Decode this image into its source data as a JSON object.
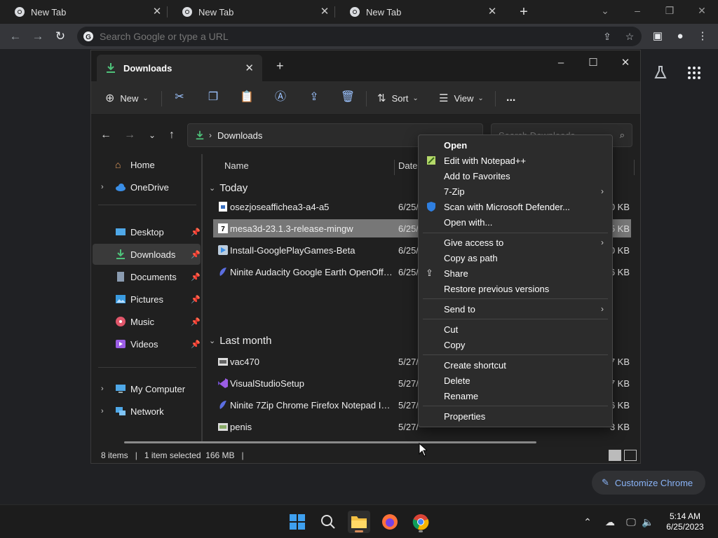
{
  "chrome": {
    "tabs": [
      {
        "title": "New Tab"
      },
      {
        "title": "New Tab"
      },
      {
        "title": "New Tab"
      }
    ],
    "omnibox_placeholder": "Search Google or type a URL",
    "customize_label": "Customize Chrome"
  },
  "explorer": {
    "tab_title": "Downloads",
    "commands": {
      "new_label": "New",
      "sort_label": "Sort",
      "view_label": "View",
      "more_label": "..."
    },
    "address": "Downloads",
    "search_placeholder": "Search Downloads",
    "sidebar": [
      {
        "label": "Home"
      },
      {
        "label": "OneDrive"
      },
      {
        "label": "Desktop"
      },
      {
        "label": "Downloads"
      },
      {
        "label": "Documents"
      },
      {
        "label": "Pictures"
      },
      {
        "label": "Music"
      },
      {
        "label": "Videos"
      },
      {
        "label": "My Computer"
      },
      {
        "label": "Network"
      }
    ],
    "columns": {
      "name": "Name",
      "date": "Date"
    },
    "groups": {
      "today": "Today",
      "last_month": "Last month"
    },
    "files": [
      {
        "name": "osezjoseaffichea3-a4-a5",
        "date": "6/25/",
        "size": "0 KB"
      },
      {
        "name": "mesa3d-23.1.3-release-mingw",
        "date": "6/25/",
        "size": "5 KB"
      },
      {
        "name": "Install-GooglePlayGames-Beta",
        "date": "6/25/",
        "size": "0 KB"
      },
      {
        "name": "Ninite Audacity Google Earth OpenOffice...",
        "date": "6/25/",
        "size": "6 KB"
      },
      {
        "name": "vac470",
        "date": "5/27/",
        "size": "7 KB"
      },
      {
        "name": "VisualStudioSetup",
        "date": "5/27/",
        "size": "7 KB"
      },
      {
        "name": "Ninite 7Zip Chrome Firefox Notepad Inst...",
        "date": "5/27/",
        "size": "6 KB"
      },
      {
        "name": "penis",
        "date": "5/27/",
        "size": "3 KB"
      }
    ],
    "status": {
      "items": "8 items",
      "selected": "1 item selected  166 MB"
    }
  },
  "context_menu": [
    {
      "label": "Open"
    },
    {
      "label": "Edit with Notepad++"
    },
    {
      "label": "Add to Favorites"
    },
    {
      "label": "7-Zip"
    },
    {
      "label": "Scan with Microsoft Defender..."
    },
    {
      "label": "Open with..."
    },
    {
      "label": "Give access to"
    },
    {
      "label": "Copy as path"
    },
    {
      "label": "Share"
    },
    {
      "label": "Restore previous versions"
    },
    {
      "label": "Send to"
    },
    {
      "label": "Cut"
    },
    {
      "label": "Copy"
    },
    {
      "label": "Create shortcut"
    },
    {
      "label": "Delete"
    },
    {
      "label": "Rename"
    },
    {
      "label": "Properties"
    }
  ],
  "taskbar": {
    "time": "5:14 AM",
    "date": "6/25/2023"
  },
  "colors": {
    "accent": "#8ab4f8",
    "selected_row": "#777777",
    "explorer_bg": "#202020"
  }
}
